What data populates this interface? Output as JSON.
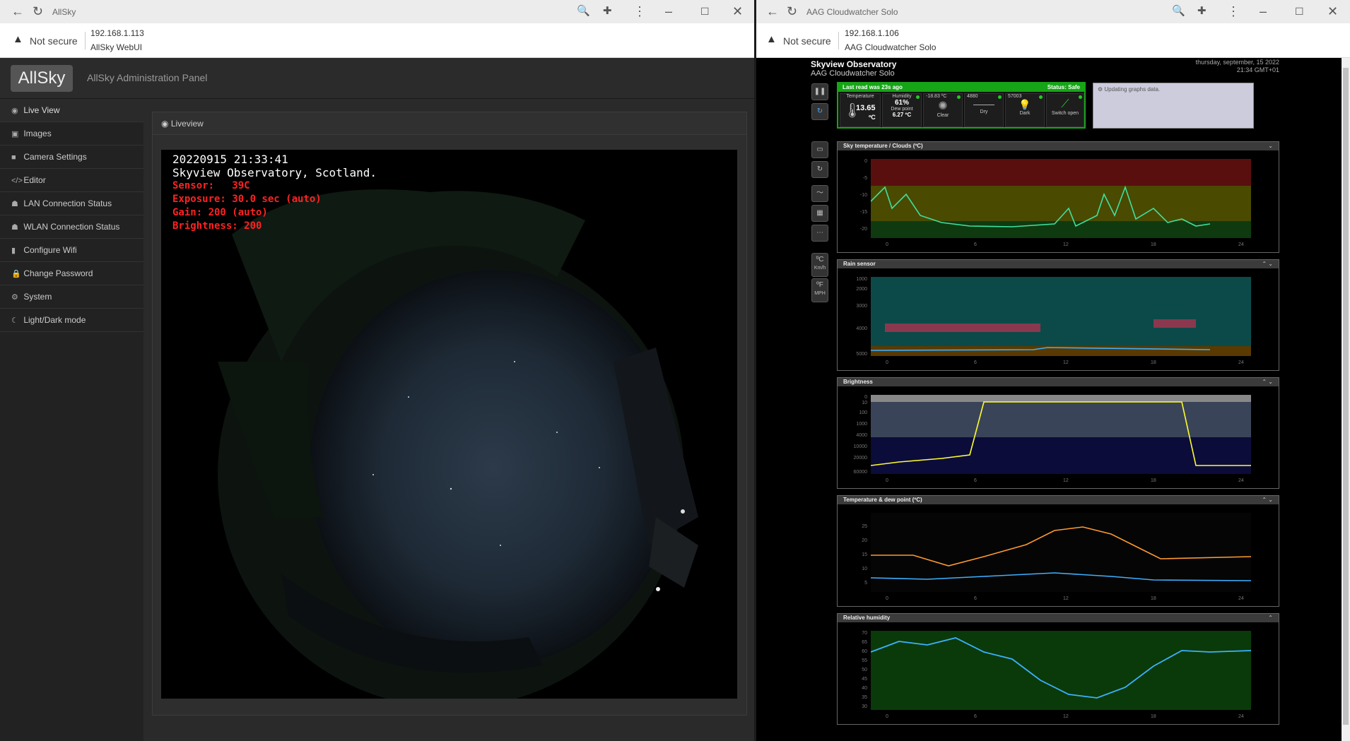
{
  "left_window": {
    "tab_title": "AllSky",
    "not_secure": "Not secure",
    "url_ip": "192.168.1.113",
    "url_title": "AllSky WebUI",
    "brand": "AllSky",
    "app_title": "AllSky Administration Panel",
    "nav": [
      {
        "label": "Live View",
        "icon": "eye-icon"
      },
      {
        "label": "Images",
        "icon": "images-icon"
      },
      {
        "label": "Camera Settings",
        "icon": "camera-icon"
      },
      {
        "label": "Editor",
        "icon": "code-icon"
      },
      {
        "label": "LAN Connection Status",
        "icon": "network-icon"
      },
      {
        "label": "WLAN Connection Status",
        "icon": "wifi-status-icon"
      },
      {
        "label": "Configure Wifi",
        "icon": "signal-icon"
      },
      {
        "label": "Change Password",
        "icon": "lock-icon"
      },
      {
        "label": "System",
        "icon": "cog-icon"
      },
      {
        "label": "Light/Dark mode",
        "icon": "moon-icon"
      }
    ],
    "panel_title": "Liveview",
    "overlay": {
      "timestamp": "20220915 21:33:41",
      "location": "Skyview Observatory, Scotland.",
      "sensor": "Sensor:   39C",
      "exposure": "Exposure: 30.0 sec (auto)",
      "gain": "Gain: 200 (auto)",
      "brightness": "Brightness: 200"
    }
  },
  "right_window": {
    "tab_title": "AAG Cloudwatcher Solo",
    "not_secure": "Not secure",
    "url_ip": "192.168.1.106",
    "url_title": "AAG Cloudwatcher Solo",
    "obs_title": "Skyview Observatory",
    "obs_subtitle": "AAG Cloudwatcher Solo",
    "date_line1": "thursday, september, 15 2022",
    "date_line2": "21:34 GMT+01",
    "last_read": "Last read was 23s ago",
    "status": "Status: Safe",
    "cells": {
      "temperature_label": "Temperature",
      "temperature_value": "13.65",
      "temperature_unit": "ºC",
      "humidity_label": "Humidity",
      "humidity_value": "61%",
      "dewpoint_label": "Dew point",
      "dewpoint_value": "6.27 ºC",
      "cloud_top": "-18.83 ºC",
      "cloud_label": "Clear",
      "rain_top": "4880",
      "rain_label": "Dry",
      "light_top": "57003",
      "light_label": "Dark",
      "switch_label": "Switch open"
    },
    "notice": "Updating graphs data.",
    "units": {
      "c": "ºC",
      "kmh": "Km/h",
      "f": "ºF",
      "mph": "MPH"
    },
    "graphs": [
      {
        "title": "Sky temperature / Clouds (ºC)",
        "controls": "⌄",
        "yticks": [
          "0",
          "-5",
          "-10",
          "-15",
          "-20"
        ],
        "xticks": [
          "0",
          "6",
          "12",
          "18",
          "24"
        ]
      },
      {
        "title": "Rain sensor",
        "controls": "⌃ ⌄",
        "yticks": [
          "1000",
          "2000",
          "3000",
          "4000",
          "5000"
        ],
        "xticks": [
          "0",
          "6",
          "12",
          "18",
          "24"
        ]
      },
      {
        "title": "Brightness",
        "controls": "⌃ ⌄",
        "yticks": [
          "0",
          "10",
          "100",
          "1000",
          "4000",
          "10000",
          "20000",
          "60000"
        ],
        "xticks": [
          "0",
          "6",
          "12",
          "18",
          "24"
        ]
      },
      {
        "title": "Temperature & dew point (ºC)",
        "controls": "⌃ ⌄",
        "yticks": [
          "25",
          "20",
          "15",
          "10",
          "5"
        ],
        "xticks": [
          "0",
          "6",
          "12",
          "18",
          "24"
        ]
      },
      {
        "title": "Relative humidity",
        "controls": "⌃",
        "yticks": [
          "70",
          "65",
          "60",
          "55",
          "50",
          "45",
          "40",
          "35",
          "30"
        ],
        "xticks": [
          "0",
          "6",
          "12",
          "18",
          "24"
        ]
      }
    ]
  }
}
